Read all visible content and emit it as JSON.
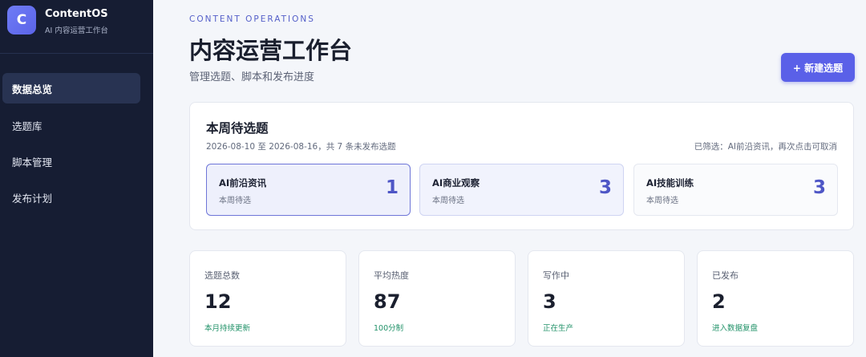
{
  "sidebar": {
    "logo_letter": "C",
    "app_name": "ContentOS",
    "app_subtitle": "AI 内容运营工作台",
    "items": [
      {
        "label": "数据总览"
      },
      {
        "label": "选题库"
      },
      {
        "label": "脚本管理"
      },
      {
        "label": "发布计划"
      }
    ]
  },
  "header": {
    "eyebrow": "CONTENT OPERATIONS",
    "title": "内容运营工作台",
    "subtitle": "管理选题、脚本和发布进度",
    "new_button_label": "+ 新建选题"
  },
  "weekly": {
    "title": "本周待选题",
    "range_text": "2026-08-10 至 2026-08-16，共 7 条未发布选题",
    "filter_text": "已筛选：AI前沿资讯，再次点击可取消",
    "cards": [
      {
        "name": "AI前沿资讯",
        "sub": "本周待选",
        "count": "1"
      },
      {
        "name": "AI商业观察",
        "sub": "本周待选",
        "count": "3"
      },
      {
        "name": "AI技能训练",
        "sub": "本周待选",
        "count": "3"
      }
    ]
  },
  "stats": [
    {
      "label": "选题总数",
      "value": "12",
      "note": "本月持续更新"
    },
    {
      "label": "平均热度",
      "value": "87",
      "note": "100分制"
    },
    {
      "label": "写作中",
      "value": "3",
      "note": "正在生产"
    },
    {
      "label": "已发布",
      "value": "2",
      "note": "进入数据复盘"
    }
  ],
  "colors": {
    "sidebar_bg": "#161d33",
    "accent": "#5a60e8",
    "positive_note": "#23936a",
    "page_bg": "#f4f6fa"
  }
}
